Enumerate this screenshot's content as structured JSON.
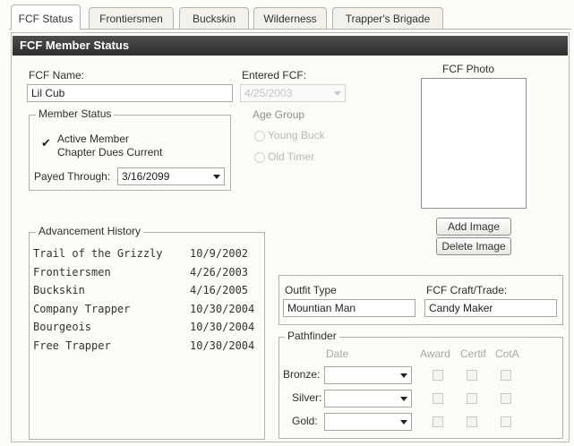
{
  "tabs": [
    {
      "label": "FCF Status",
      "active": true
    },
    {
      "label": "Frontiersmen",
      "active": false
    },
    {
      "label": "Buckskin",
      "active": false
    },
    {
      "label": "Wilderness",
      "active": false
    },
    {
      "label": "Trapper's Brigade",
      "active": false
    }
  ],
  "header": {
    "title": "FCF Member Status"
  },
  "form": {
    "fcf_name_label": "FCF Name:",
    "fcf_name_value": "Lil Cub",
    "entered_fcf_label": "Entered FCF:",
    "entered_fcf_value": "4/25/2003",
    "age_group_label": "Age Group",
    "age_group_options": [
      "Young Buck",
      "Old Timer"
    ],
    "photo_label": "FCF Photo",
    "add_image": "Add Image",
    "delete_image": "Delete Image"
  },
  "member_status": {
    "legend": "Member Status",
    "active_member_label": "Active Member",
    "chapter_dues_label": "Chapter Dues Current",
    "active_checked": true,
    "payed_through_label": "Payed Through:",
    "payed_through_value": "3/16/2099"
  },
  "advancement": {
    "legend": "Advancement History",
    "rows": [
      {
        "name": "Trail of the Grizzly",
        "date": "10/9/2002"
      },
      {
        "name": "Frontiersmen",
        "date": "4/26/2003"
      },
      {
        "name": "Buckskin",
        "date": "4/16/2005"
      },
      {
        "name": "Company Trapper",
        "date": "10/30/2004"
      },
      {
        "name": "Bourgeois",
        "date": "10/30/2004"
      },
      {
        "name": "Free Trapper",
        "date": "10/30/2004"
      }
    ]
  },
  "outfit": {
    "outfit_type_label": "Outfit Type",
    "outfit_type_value": "Mountian Man",
    "craft_label": "FCF Craft/Trade:",
    "craft_value": "Candy Maker"
  },
  "pathfinder": {
    "legend": "Pathfinder",
    "col_date": "Date",
    "col_award": "Award",
    "col_certif": "Certif",
    "col_cota": "CotA",
    "levels": [
      "Bronze:",
      "Silver:",
      "Gold:"
    ]
  }
}
